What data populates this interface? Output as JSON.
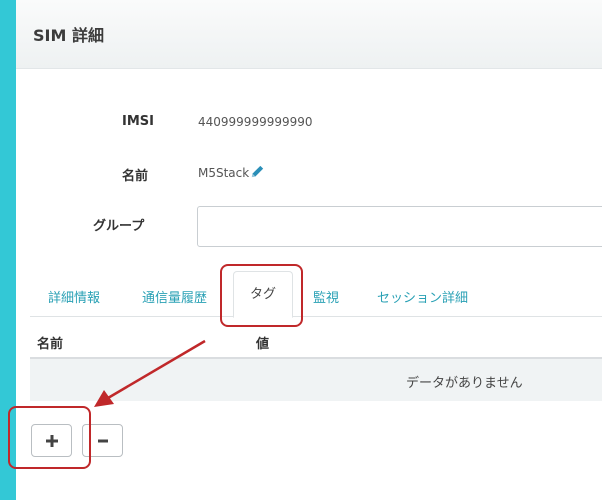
{
  "header": {
    "title": "SIM 詳細"
  },
  "fields": {
    "imsi": {
      "label": "IMSI",
      "value": "440999999999990"
    },
    "name": {
      "label": "名前",
      "value": "M5Stack"
    },
    "group": {
      "label": "グループ",
      "value": ""
    }
  },
  "tabs": [
    {
      "label": "詳細情報"
    },
    {
      "label": "通信量履歴"
    },
    {
      "label": "タグ",
      "active": true
    },
    {
      "label": "監視"
    },
    {
      "label": "セッション詳細"
    }
  ],
  "table": {
    "columns": [
      "名前",
      "値"
    ],
    "empty_text": "データがありません"
  },
  "buttons": {
    "add_symbol": "+",
    "remove_symbol": "−"
  },
  "icons": {
    "edit": "pencil-icon"
  },
  "colors": {
    "accent": "#33c8d6",
    "tab_link": "#2aa1b5",
    "annotation": "#c0282a"
  }
}
